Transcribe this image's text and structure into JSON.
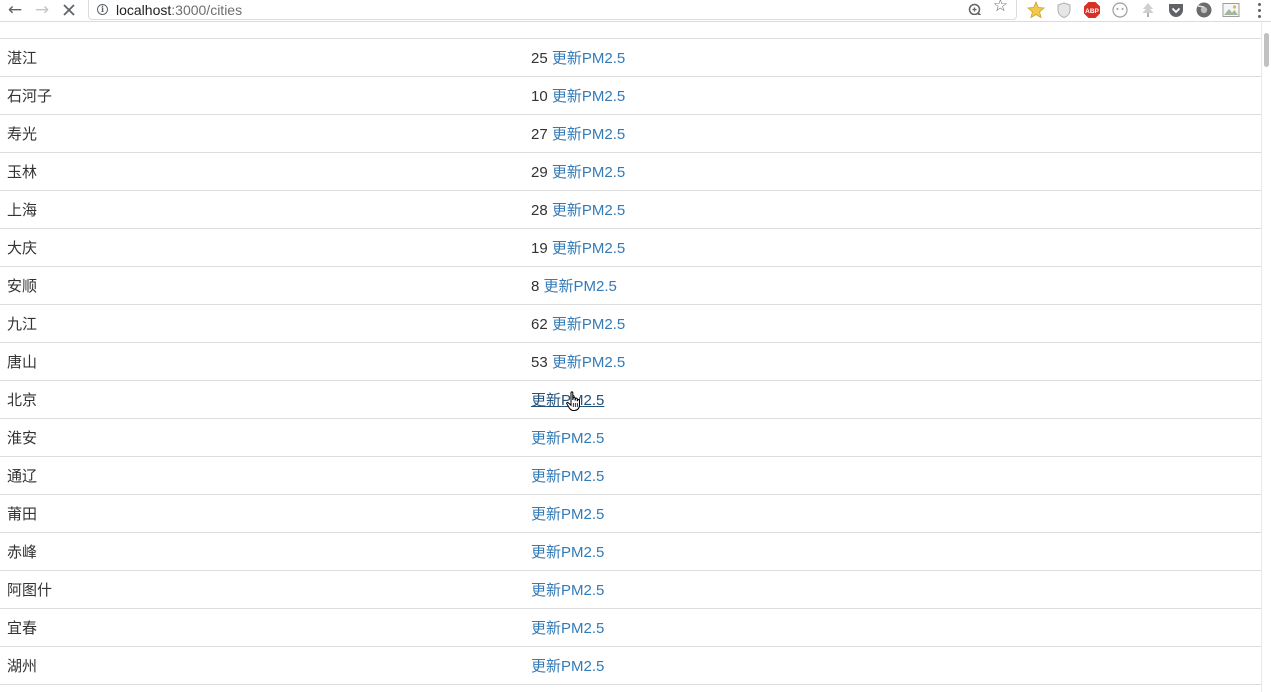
{
  "browser": {
    "url_host": "localhost",
    "url_path": ":3000/cities",
    "back_icon": "arrow-left-icon",
    "forward_icon": "arrow-right-icon",
    "stop_icon": "close-icon",
    "extensions": [
      {
        "name": "star-extension-icon",
        "color": "#f2c94c"
      },
      {
        "name": "shield-extension-icon",
        "color": "#b0b0b0"
      },
      {
        "name": "adblock-icon",
        "label": "ABP",
        "color": "#d93025"
      },
      {
        "name": "face-extension-icon",
        "color": "#9e9e9e"
      },
      {
        "name": "tree-extension-icon",
        "color": "#b0b0b0"
      },
      {
        "name": "pocket-icon",
        "color": "#5f6368"
      },
      {
        "name": "camera-extension-icon",
        "color": "#5f6368"
      },
      {
        "name": "image-extension-icon",
        "color": "#9e9e9e"
      }
    ]
  },
  "link_label": "更新PM2.5",
  "colors": {
    "link": "#337ab7",
    "link_hover": "#23527c",
    "text": "#333333",
    "border": "#dddddd"
  },
  "cities": [
    {
      "name": "湛江",
      "pm": "25"
    },
    {
      "name": "石河子",
      "pm": "10"
    },
    {
      "name": "寿光",
      "pm": "27"
    },
    {
      "name": "玉林",
      "pm": "29"
    },
    {
      "name": "上海",
      "pm": "28"
    },
    {
      "name": "大庆",
      "pm": "19"
    },
    {
      "name": "安顺",
      "pm": "8"
    },
    {
      "name": "九江",
      "pm": "62"
    },
    {
      "name": "唐山",
      "pm": "53"
    },
    {
      "name": "北京",
      "pm": "",
      "hover": true
    },
    {
      "name": "淮安",
      "pm": ""
    },
    {
      "name": "通辽",
      "pm": ""
    },
    {
      "name": "莆田",
      "pm": ""
    },
    {
      "name": "赤峰",
      "pm": ""
    },
    {
      "name": "阿图什",
      "pm": ""
    },
    {
      "name": "宜春",
      "pm": ""
    },
    {
      "name": "湖州",
      "pm": ""
    }
  ]
}
